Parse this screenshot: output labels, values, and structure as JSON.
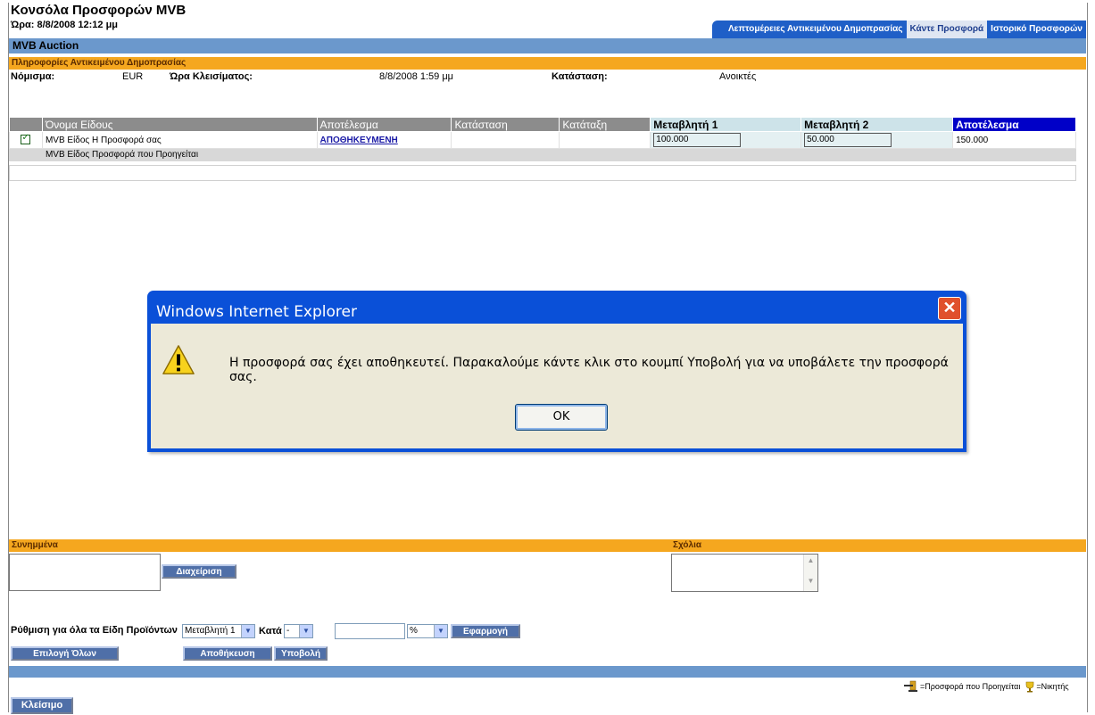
{
  "page": {
    "title": "Κονσόλα Προσφορών MVB",
    "time": "Ώρα: 8/8/2008 12:12 μμ",
    "tabs": [
      "Λεπτομέρειες Αντικειμένου Δημοπρασίας",
      "Κάντε Προσφορά",
      "Ιστορικό Προσφορών"
    ],
    "active_tab": "Κάντε Προσφορά",
    "header_bar": "MVB Auction",
    "info_section": "Πληροφορίες Αντικειμένου Δημοπρασίας"
  },
  "info": {
    "currency_label": "Νόμισμα:",
    "currency_value": "EUR",
    "close_time_label": "Ώρα Κλεισίματος:",
    "close_time_value": "8/8/2008 1:59 μμ",
    "status_label": "Κατάσταση:",
    "status_value": "Ανοικτές"
  },
  "grid": {
    "headers": [
      "Όνομα Είδους",
      "Αποτέλεσμα",
      "Κατάσταση",
      "Κατάταξη",
      "Μεταβλητή 1",
      "Μεταβλητή 2",
      "Αποτέλεσμα"
    ],
    "row1": {
      "name": "MVB Είδος Η Προσφορά σας",
      "result": "ΑΠΟΘΗΚΕΥΜΕΝΗ",
      "var1": "100.000",
      "var2": "50.000",
      "total": "150.000"
    },
    "row2": {
      "name": "MVB Είδος Προσφορά που Προηγείται"
    }
  },
  "attachments": {
    "label": "Συνημμένα",
    "manage_button": "Διαχείριση"
  },
  "comments": {
    "label": "Σχόλια"
  },
  "bulk": {
    "label": "Ρύθμιση για όλα τα Είδη Προϊόντων",
    "variable": "Μεταβλητή 1",
    "by_label": "Κατά",
    "by_value": "-",
    "unit": "%",
    "apply_button": "Εφαρμογή"
  },
  "buttons": {
    "select_all": "Επιλογή Όλων",
    "save": "Αποθήκευση",
    "submit": "Υποβολή",
    "close": "Κλείσιμο"
  },
  "legend": {
    "leading": "=Προσφορά που Προηγείται",
    "winner": "=Νικητής"
  },
  "dialog": {
    "title": "Windows Internet Explorer",
    "message": "Η προσφορά σας έχει αποθηκευτεί. Παρακαλούμε κάντε κλικ στο κουμπί Υποβολή για να υποβάλετε την προσφορά σας.",
    "ok": "OK"
  },
  "colors": {
    "tab_blue": "#1f5fc7",
    "header_blue": "#6b98cc",
    "section_orange": "#f5a71f",
    "dialog_blue": "#0a50d8"
  }
}
